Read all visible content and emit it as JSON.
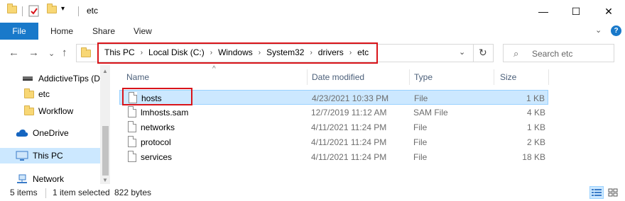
{
  "window": {
    "title": "etc",
    "minimize": "—",
    "maximize": "☐",
    "close": "✕"
  },
  "ribbon": {
    "tabs": [
      "File",
      "Home",
      "Share",
      "View"
    ],
    "help": "?",
    "expand": "⌄"
  },
  "nav": {
    "back": "←",
    "forward": "→",
    "recent": "⌄",
    "up": "↑",
    "breadcrumbs": [
      "This PC",
      "Local Disk (C:)",
      "Windows",
      "System32",
      "drivers",
      "etc"
    ],
    "breadcrumb_separator": "›",
    "dropdown": "⌄",
    "refresh": "↻",
    "search_placeholder": "Search etc",
    "search_icon_glyph": "⌕"
  },
  "sidebar": {
    "items": [
      {
        "label": "AddictiveTips (D",
        "icon": "drive-icon"
      },
      {
        "label": "etc",
        "icon": "folder-icon"
      },
      {
        "label": "Workflow",
        "icon": "folder-icon"
      },
      {
        "label": "OneDrive",
        "icon": "cloud-icon"
      },
      {
        "label": "This PC",
        "icon": "computer-icon",
        "selected": true
      },
      {
        "label": "Network",
        "icon": "network-icon"
      }
    ]
  },
  "file_list": {
    "columns": [
      "Name",
      "Date modified",
      "Type",
      "Size"
    ],
    "sort_indicator": "^",
    "rows": [
      {
        "name": "hosts",
        "date": "4/23/2021 10:33 PM",
        "type": "File",
        "size": "1 KB",
        "selected": true
      },
      {
        "name": "lmhosts.sam",
        "date": "12/7/2019 11:12 AM",
        "type": "SAM File",
        "size": "4 KB"
      },
      {
        "name": "networks",
        "date": "4/11/2021 11:24 PM",
        "type": "File",
        "size": "1 KB"
      },
      {
        "name": "protocol",
        "date": "4/11/2021 11:24 PM",
        "type": "File",
        "size": "2 KB"
      },
      {
        "name": "services",
        "date": "4/11/2021 11:24 PM",
        "type": "File",
        "size": "18 KB"
      }
    ]
  },
  "status": {
    "items": "5 items",
    "selection": "1 item selected",
    "size": "822 bytes"
  },
  "colors": {
    "accent": "#1979ca",
    "selection": "#cce8ff",
    "highlight_box": "#d9141a",
    "folder": "#f8d775"
  }
}
